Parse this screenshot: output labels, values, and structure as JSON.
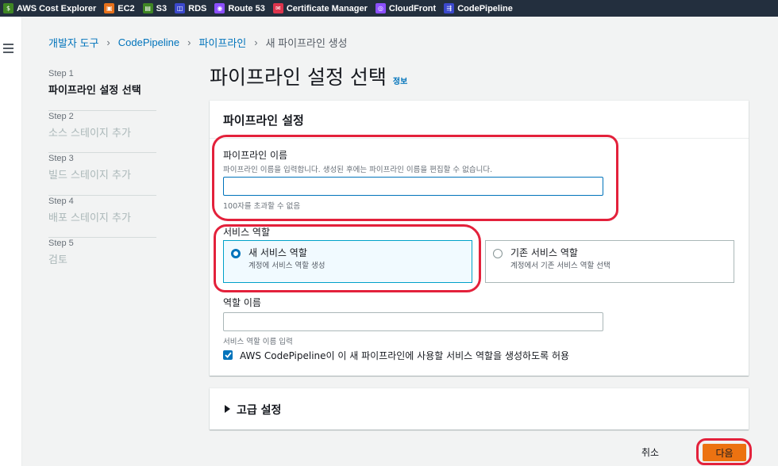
{
  "favorites": [
    {
      "label": "AWS Cost Explorer",
      "icon": "cost-explorer-icon",
      "color": "#3f8624"
    },
    {
      "label": "EC2",
      "icon": "ec2-icon",
      "color": "#e7711b"
    },
    {
      "label": "S3",
      "icon": "s3-icon",
      "color": "#3f8624"
    },
    {
      "label": "RDS",
      "icon": "rds-icon",
      "color": "#3b48cc"
    },
    {
      "label": "Route 53",
      "icon": "route53-icon",
      "color": "#8c4fff"
    },
    {
      "label": "Certificate Manager",
      "icon": "certificate-manager-icon",
      "color": "#dd344c"
    },
    {
      "label": "CloudFront",
      "icon": "cloudfront-icon",
      "color": "#8c4fff"
    },
    {
      "label": "CodePipeline",
      "icon": "codepipeline-icon",
      "color": "#3b48cc"
    }
  ],
  "breadcrumb": {
    "item1": "개발자 도구",
    "item2": "CodePipeline",
    "item3": "파이프라인",
    "current": "새 파이프라인 생성"
  },
  "steps": [
    {
      "no": "Step 1",
      "title": "파이프라인 설정 선택"
    },
    {
      "no": "Step 2",
      "title": "소스 스테이지 추가"
    },
    {
      "no": "Step 3",
      "title": "빌드 스테이지 추가"
    },
    {
      "no": "Step 4",
      "title": "배포 스테이지 추가"
    },
    {
      "no": "Step 5",
      "title": "검토"
    }
  ],
  "page": {
    "title": "파이프라인 설정 선택",
    "info_link": "정보"
  },
  "settings": {
    "header": "파이프라인 설정",
    "name_label": "파이프라인 이름",
    "name_desc": "파이프라인 이름을 입력합니다. 생성된 후에는 파이프라인 이름을 편집할 수 없습니다.",
    "name_value": "",
    "name_constraint": "100자를 초과할 수 없음",
    "service_role_label": "서비스 역할",
    "new_role_title": "새 서비스 역할",
    "new_role_desc": "계정에 서비스 역할 생성",
    "existing_role_title": "기존 서비스 역할",
    "existing_role_desc": "계정에서 기존 서비스 역할 선택",
    "role_name_label": "역할 이름",
    "role_name_value": "",
    "role_name_desc": "서비스 역할 이름 입력",
    "allow_checkbox_label": "AWS CodePipeline이 이 새 파이프라인에 사용할 서비스 역할을 생성하도록 허용"
  },
  "advanced": {
    "title": "고급 설정"
  },
  "actions": {
    "cancel": "취소",
    "next": "다음"
  }
}
